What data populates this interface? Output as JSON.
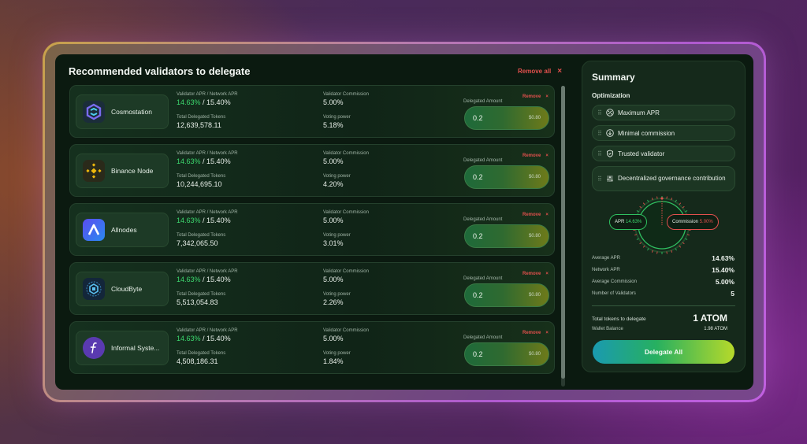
{
  "left": {
    "title": "Recommended validators to delegate",
    "remove_all_label": "Remove all",
    "close_glyph": "×"
  },
  "labels": {
    "apr": "Validator APR / Network APR",
    "total_tokens": "Total Delegated Tokens",
    "commission": "Validator Commission",
    "voting_power": "Voting power",
    "delegated_amount": "Delegated Amount",
    "remove": "Remove"
  },
  "validators": [
    {
      "name": "Cosmostation",
      "apr": "14.63%",
      "network_apr": "/ 15.40%",
      "total_tokens": "12,639,578.11",
      "commission": "5.00%",
      "voting_power": "5.18%",
      "amount": "0.2",
      "usd": "$0.80",
      "icon": "cosmostation-logo-icon"
    },
    {
      "name": "Binance Node",
      "apr": "14.63%",
      "network_apr": "/ 15.40%",
      "total_tokens": "10,244,695.10",
      "commission": "5.00%",
      "voting_power": "4.20%",
      "amount": "0.2",
      "usd": "$0.80",
      "icon": "binance-logo-icon"
    },
    {
      "name": "Allnodes",
      "apr": "14.63%",
      "network_apr": "/ 15.40%",
      "total_tokens": "7,342,065.50",
      "commission": "5.00%",
      "voting_power": "3.01%",
      "amount": "0.2",
      "usd": "$0.80",
      "icon": "allnodes-logo-icon"
    },
    {
      "name": "CloudByte",
      "apr": "14.63%",
      "network_apr": "/ 15.40%",
      "total_tokens": "5,513,054.83",
      "commission": "5.00%",
      "voting_power": "2.26%",
      "amount": "0.2",
      "usd": "$0.80",
      "icon": "cloudbyte-logo-icon"
    },
    {
      "name": "Informal Syste...",
      "apr": "14.63%",
      "network_apr": "/ 15.40%",
      "total_tokens": "4,508,186.31",
      "commission": "5.00%",
      "voting_power": "1.84%",
      "amount": "0.2",
      "usd": "$0.80",
      "icon": "informal-systems-logo-icon"
    }
  ],
  "summary": {
    "title": "Summary",
    "optimization_title": "Optimization",
    "options": [
      {
        "label": "Maximum APR",
        "icon": "percent-icon"
      },
      {
        "label": "Minimal commission",
        "icon": "down-arrow-circle-icon"
      },
      {
        "label": "Trusted validator",
        "icon": "shield-icon"
      },
      {
        "label": "Decentralized governance contribution",
        "icon": "sliders-icon"
      }
    ],
    "gauge": {
      "apr_label": "APR",
      "apr_value": "14.63%",
      "commission_label": "Commission",
      "commission_value": "5.00%"
    },
    "stats": [
      {
        "label": "Average APR",
        "value": "14.63%"
      },
      {
        "label": "Network APR",
        "value": "15.40%"
      },
      {
        "label": "Average Commission",
        "value": "5.00%"
      },
      {
        "label": "Number of Validators",
        "value": "5"
      }
    ],
    "total_label": "Total tokens to delegate",
    "total_value": "1 ATOM",
    "wallet_label": "Wallet Balance",
    "wallet_value": "1.98 ATOM",
    "delegate_all_label": "Delegate All"
  },
  "colors": {
    "accent_green": "#3dd96f",
    "remove_red": "#e2504d",
    "background": "#0b1a10"
  }
}
